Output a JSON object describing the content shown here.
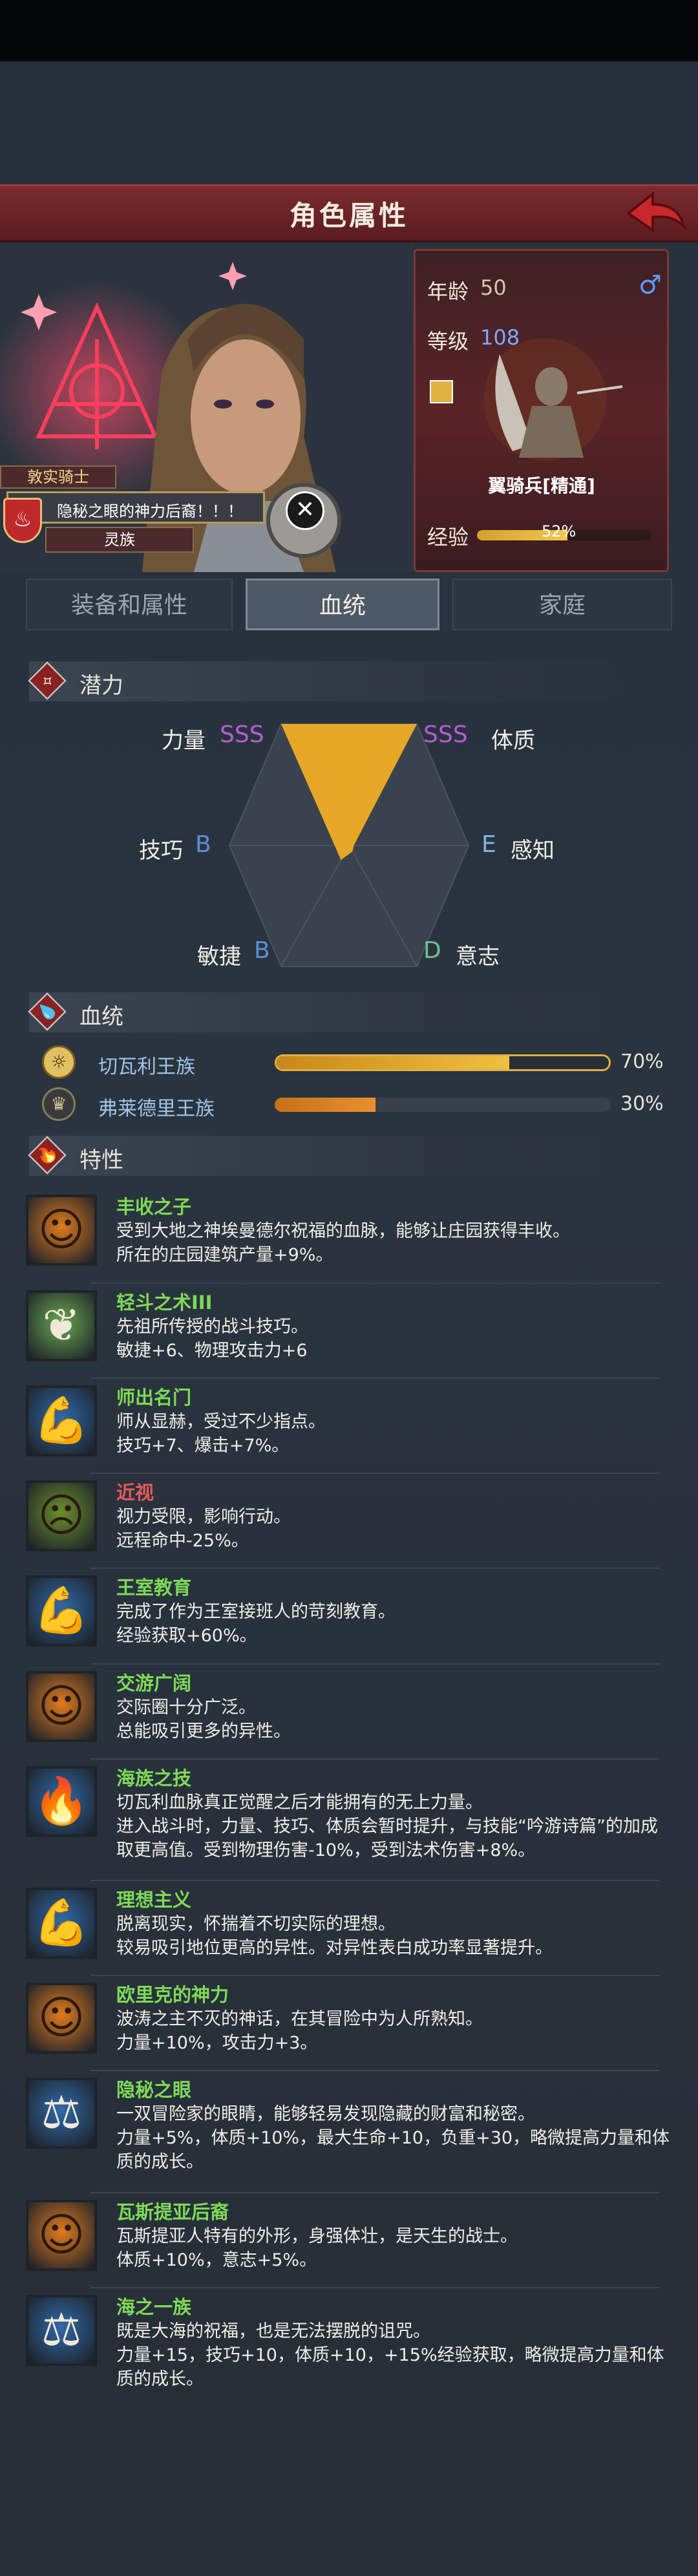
{
  "header": {
    "title": "角色属性"
  },
  "character": {
    "rank_label": "敦实骑士",
    "title": "隐秘之眼的神力后裔！！！",
    "race": "灵族",
    "age_label": "年龄",
    "age": "50",
    "gender_icon": "male-icon",
    "level_label": "等级",
    "level": "108",
    "unit_name": "翼骑兵[精通]",
    "exp_label": "经验",
    "exp_value": "52%",
    "exp_fraction": 0.52
  },
  "tabs": [
    {
      "label": "装备和属性",
      "active": false
    },
    {
      "label": "血统",
      "active": true
    },
    {
      "label": "家庭",
      "active": false
    }
  ],
  "potential": {
    "title": "潜力",
    "stats": [
      {
        "name": "力量",
        "grade": "SSS"
      },
      {
        "name": "体质",
        "grade": "SSS"
      },
      {
        "name": "感知",
        "grade": "E"
      },
      {
        "name": "意志",
        "grade": "D"
      },
      {
        "name": "敏捷",
        "grade": "B"
      },
      {
        "name": "技巧",
        "grade": "B"
      }
    ],
    "colors": {
      "SSS": "#b65cd6",
      "B": "#5a8fd4",
      "E": "#7fb3e6",
      "D": "#6ec28a"
    }
  },
  "bloodline": {
    "title": "血统",
    "entries": [
      {
        "name": "切瓦利王族",
        "percent": "70%",
        "fraction": 0.7
      },
      {
        "name": "弗莱德里王族",
        "percent": "30%",
        "fraction": 0.3
      }
    ]
  },
  "traits": {
    "title": "特性",
    "items": [
      {
        "name": "丰收之子",
        "color": "#7ed957",
        "icon": "happy-face-icon",
        "bg": "#e07a1e",
        "desc": "受到大地之神埃曼德尔祝福的血脉，能够让庄园获得丰收。\n所在的庄园建筑产量+9%。"
      },
      {
        "name": "轻斗之术III",
        "color": "#7ed957",
        "icon": "leaf-icon",
        "bg": "#6aa84f",
        "desc": "先祖所传授的战斗技巧。\n敏捷+6、物理攻击力+6"
      },
      {
        "name": "师出名门",
        "color": "#7ed957",
        "icon": "flexed-arm-icon",
        "bg": "#2f6aa8",
        "desc": "师从显赫，受过不少指点。\n技巧+7、爆击+7%。"
      },
      {
        "name": "近视",
        "color": "#e65a5a",
        "icon": "sad-face-icon",
        "bg": "#6b8f2a",
        "desc": "视力受限，影响行动。\n远程命中-25%。"
      },
      {
        "name": "王室教育",
        "color": "#7ed957",
        "icon": "flexed-arm-icon",
        "bg": "#2f6aa8",
        "desc": "完成了作为王室接班人的苛刻教育。\n经验获取+60%。"
      },
      {
        "name": "交游广阔",
        "color": "#7ed957",
        "icon": "happy-face-icon",
        "bg": "#e07a1e",
        "desc": "交际圈十分广泛。\n总能吸引更多的异性。"
      },
      {
        "name": "海族之技",
        "color": "#7ed957",
        "icon": "flame-icon",
        "bg": "#2f6aa8",
        "desc": "切瓦利血脉真正觉醒之后才能拥有的无上力量。\n进入战斗时，力量、技巧、体质会暂时提升，与技能“吟游诗篇”的加成取更高值。受到物理伤害-10%，受到法术伤害+8%。"
      },
      {
        "name": "理想主义",
        "color": "#7ed957",
        "icon": "flexed-arm-icon",
        "bg": "#2f6aa8",
        "desc": "脱离现实，怀揣着不切实际的理想。\n较易吸引地位更高的异性。对异性表白成功率显著提升。"
      },
      {
        "name": "欧里克的神力",
        "color": "#7ed957",
        "icon": "happy-face-icon",
        "bg": "#e07a1e",
        "desc": "波涛之主不灭的神话，在其冒险中为人所熟知。\n力量+10%，攻击力+3。"
      },
      {
        "name": "隐秘之眼",
        "color": "#7ed957",
        "icon": "scales-icon",
        "bg": "#2f6aa8",
        "desc": "一双冒险家的眼睛，能够轻易发现隐藏的财富和秘密。\n力量+5%，体质+10%，最大生命+10，负重+30，略微提高力量和体质的成长。"
      },
      {
        "name": "瓦斯提亚后裔",
        "color": "#7ed957",
        "icon": "happy-face-icon",
        "bg": "#e07a1e",
        "desc": "瓦斯提亚人特有的外形，身强体壮，是天生的战士。\n体质+10%，意志+5%。"
      },
      {
        "name": "海之一族",
        "color": "#7ed957",
        "icon": "scales-icon",
        "bg": "#2f6aa8",
        "desc": "既是大海的祝福，也是无法摆脱的诅咒。\n力量+15，技巧+10，体质+10，+15%经验获取，略微提高力量和体质的成长。"
      }
    ]
  }
}
